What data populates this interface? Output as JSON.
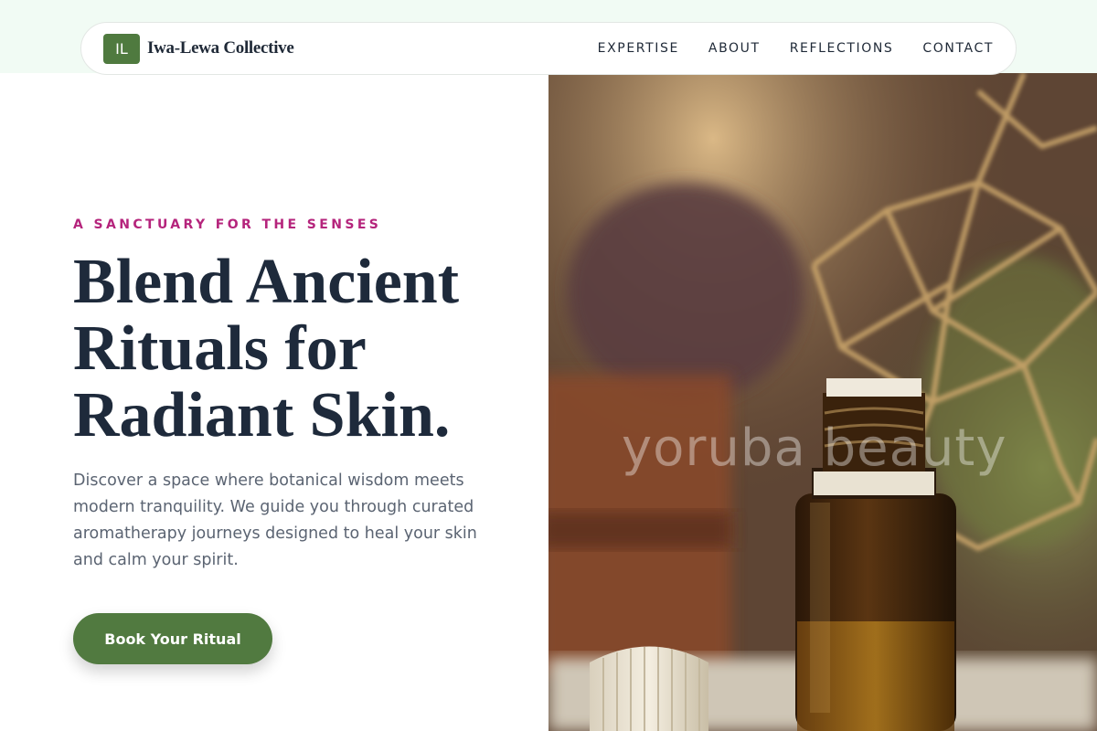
{
  "nav": {
    "logo_initials": "IL",
    "brand": "Iwa-Lewa Collective",
    "links": [
      "EXPERTISE",
      "ABOUT",
      "REFLECTIONS",
      "CONTACT"
    ]
  },
  "hero": {
    "eyebrow": "A SANCTUARY FOR THE SENSES",
    "headline": "Blend Ancient Rituals for Radiant Skin.",
    "lead": "Discover a space where botanical wisdom meets modern tranquility. We guide you through curated aromatherapy journeys designed to heal your skin and calm your spirit.",
    "cta_label": "Book Your Ritual",
    "image_watermark": "yoruba beauty"
  },
  "colors": {
    "accent_green": "#517a40",
    "eyebrow_magenta": "#b5247c",
    "headline_navy": "#1e2a3b",
    "top_band_mint": "#f1fbf4"
  }
}
